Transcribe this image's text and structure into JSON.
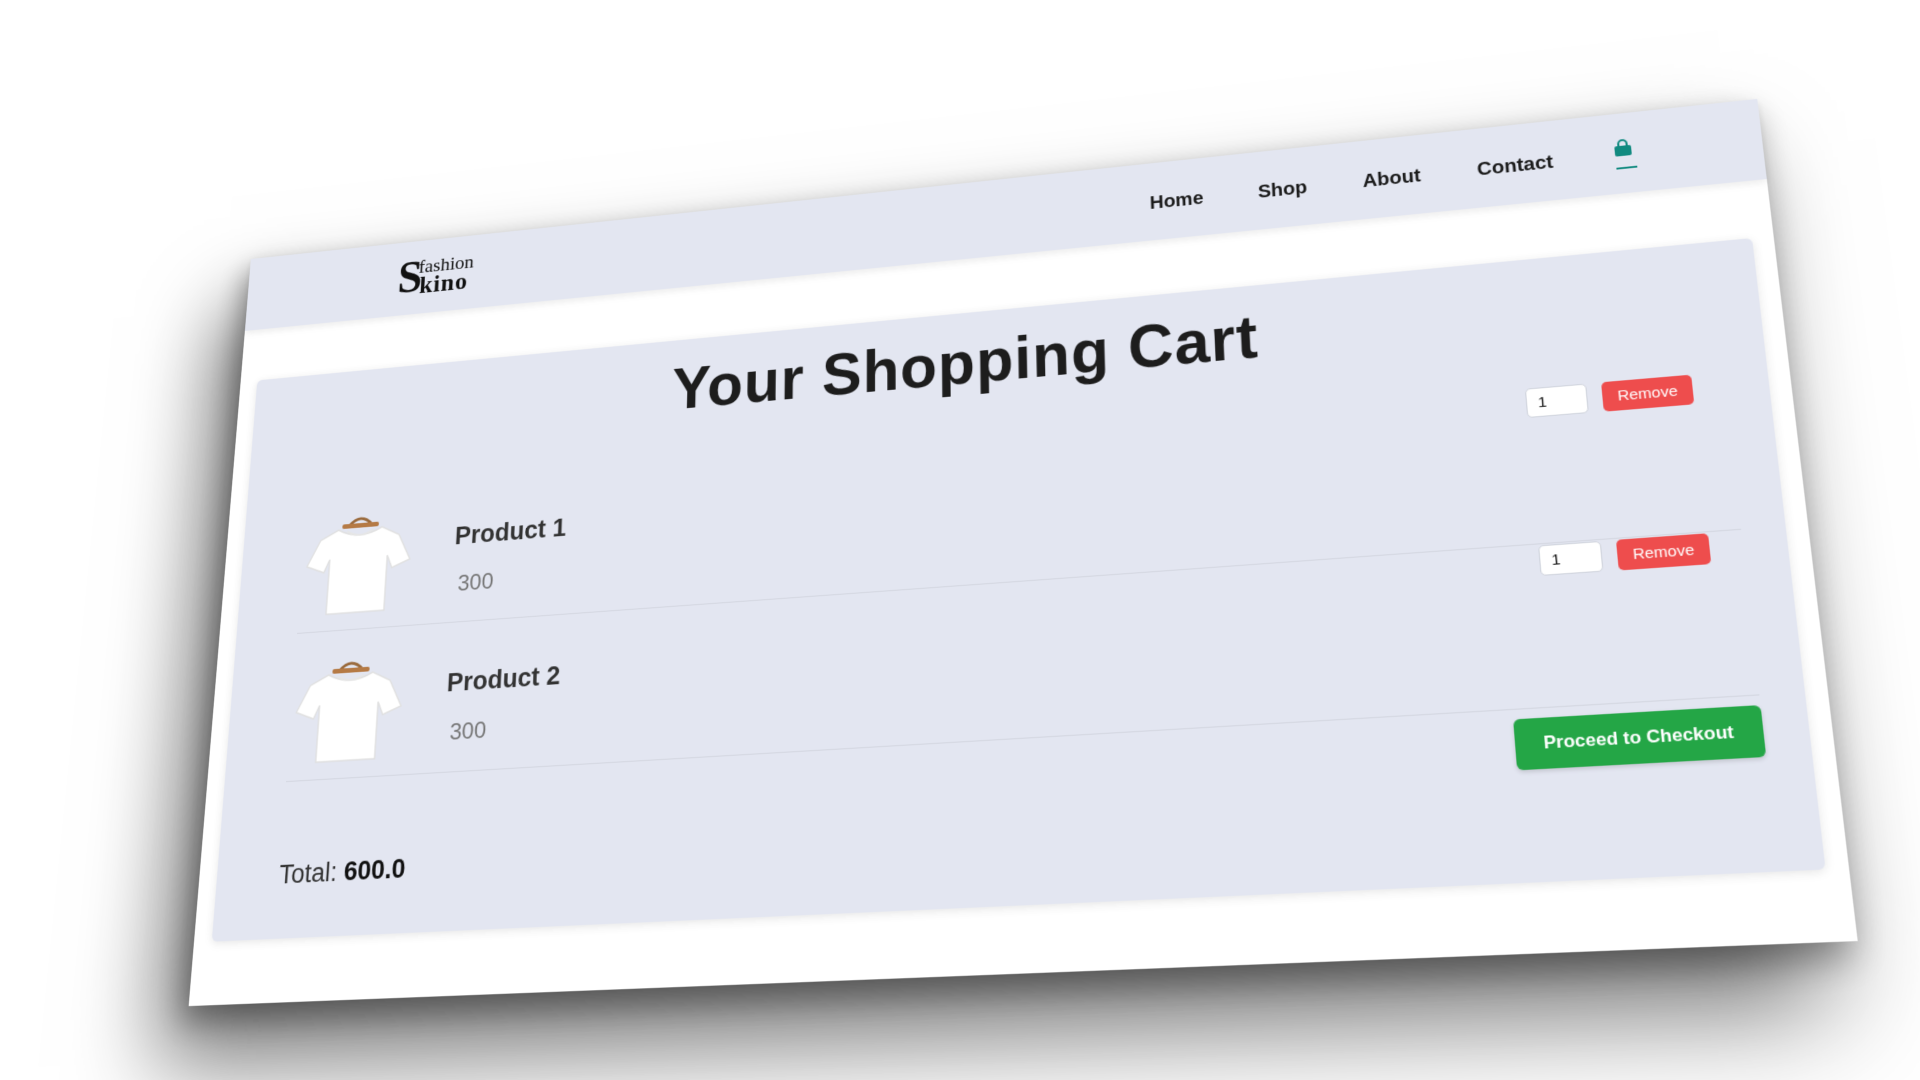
{
  "brand": {
    "logo_letter": "S",
    "logo_top": "fashion",
    "logo_bottom": "kino"
  },
  "nav": {
    "items": [
      "Home",
      "Shop",
      "About",
      "Contact"
    ],
    "cart_icon": "shopping-bag-icon"
  },
  "cart": {
    "title": "Your Shopping Cart",
    "items": [
      {
        "name": "Product 1",
        "price": "300",
        "quantity": "1",
        "remove_label": "Remove",
        "image_icon": "white-tshirt-on-hanger"
      },
      {
        "name": "Product 2",
        "price": "300",
        "quantity": "1",
        "remove_label": "Remove",
        "image_icon": "white-tshirt-on-hanger"
      }
    ],
    "checkout_label": "Proceed to Checkout",
    "total_label": "Total:",
    "total_value": "600.0"
  },
  "colors": {
    "header_bg": "#e3e6f1",
    "cart_bg": "#e3e6f1",
    "remove_button": "#ee4d4d",
    "checkout_button": "#24a646",
    "cart_icon": "#118a80"
  }
}
